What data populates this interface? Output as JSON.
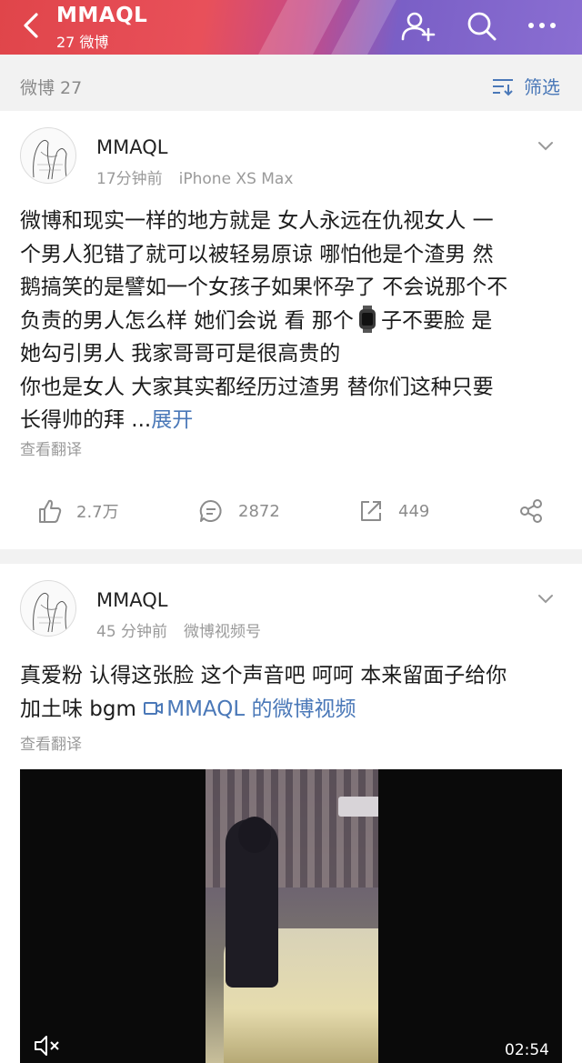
{
  "header": {
    "title": "MMAQL",
    "subtitle": "27 微博",
    "back_icon": "back-arrow-icon",
    "follow_icon": "add-user-icon",
    "search_icon": "search-icon",
    "more_icon": "more-icon"
  },
  "filterbar": {
    "count_label": "微博 27",
    "filter_label": "筛选"
  },
  "posts": [
    {
      "username": "MMAQL",
      "time": "17分钟前",
      "source": "iPhone XS Max",
      "text_lines": [
        "微博和现实一样的地方就是 女人永远在仇视女人 一",
        "个男人犯错了就可以被轻易原谅 哪怕他是个渣男 然",
        "鹅搞笑的是譬如一个女孩子如果怀孕了 不会说那个不",
        "负责的男人怎么样 她们会说 看 那个",
        "子不要脸 是",
        "她勾引男人 我家哥哥可是很高贵的",
        "你也是女人 大家其实都经历过渣男 替你们这种只要",
        "长得帅的拜 ..."
      ],
      "expand_label": "展开",
      "translate_label": "查看翻译",
      "likes": "2.7万",
      "comments": "2872",
      "reposts": "449"
    },
    {
      "username": "MMAQL",
      "time": "45 分钟前",
      "source": "微博视频号",
      "text_lines": [
        "真爱粉 认得这张脸 这个声音吧 呵呵  本来留面子给你",
        "加土味 bgm "
      ],
      "video_link": "MMAQL 的微博视频",
      "translate_label": "查看翻译",
      "video_duration": "02:54"
    }
  ],
  "colors": {
    "link": "#4a78b8",
    "muted": "#9a9a9a"
  }
}
